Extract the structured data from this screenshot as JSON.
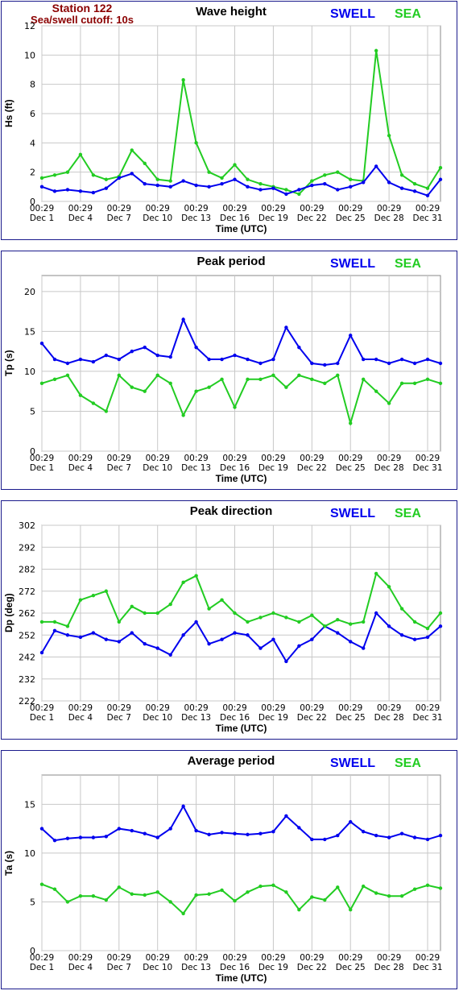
{
  "station": {
    "name": "Station 122",
    "cutoff": "Sea/swell cutoff: 10s"
  },
  "legend": {
    "swell": "SWELL",
    "sea": "SEA"
  },
  "colors": {
    "swell": "#0000ee",
    "sea": "#22cc22",
    "grid": "#c8c8c8",
    "border": "#1a1a8c",
    "station": "#8b0000"
  },
  "x_axis": {
    "label": "Time (UTC)",
    "ticks": [
      {
        "time": "00:29",
        "date": "Dec 1"
      },
      {
        "time": "00:29",
        "date": "Dec 4"
      },
      {
        "time": "00:29",
        "date": "Dec 7"
      },
      {
        "time": "00:29",
        "date": "Dec 10"
      },
      {
        "time": "00:29",
        "date": "Dec 13"
      },
      {
        "time": "00:29",
        "date": "Dec 16"
      },
      {
        "time": "00:29",
        "date": "Dec 19"
      },
      {
        "time": "00:29",
        "date": "Dec 22"
      },
      {
        "time": "00:29",
        "date": "Dec 25"
      },
      {
        "time": "00:29",
        "date": "Dec 28"
      },
      {
        "time": "00:29",
        "date": "Dec 31"
      }
    ]
  },
  "chart_data": [
    {
      "type": "line",
      "title": "Wave height",
      "ylabel": "Hs (ft)",
      "xlabel": "Time (UTC)",
      "ylim": [
        0,
        12
      ],
      "yticks": [
        0,
        2,
        4,
        6,
        8,
        10,
        12
      ],
      "grid": true,
      "legend": "top-right",
      "x": [
        "Dec 1",
        "Dec 2",
        "Dec 3",
        "Dec 4",
        "Dec 5",
        "Dec 6",
        "Dec 7",
        "Dec 8",
        "Dec 9",
        "Dec 10",
        "Dec 11",
        "Dec 12",
        "Dec 13",
        "Dec 14",
        "Dec 15",
        "Dec 16",
        "Dec 17",
        "Dec 18",
        "Dec 19",
        "Dec 20",
        "Dec 21",
        "Dec 22",
        "Dec 23",
        "Dec 24",
        "Dec 25",
        "Dec 26",
        "Dec 27",
        "Dec 28",
        "Dec 29",
        "Dec 30",
        "Dec 31",
        "Jan 1"
      ],
      "series": [
        {
          "name": "SWELL",
          "values": [
            1.0,
            0.7,
            0.8,
            0.7,
            0.6,
            0.9,
            1.6,
            1.9,
            1.2,
            1.1,
            1.0,
            1.4,
            1.1,
            1.0,
            1.2,
            1.5,
            1.0,
            0.8,
            0.9,
            0.5,
            0.8,
            1.1,
            1.2,
            0.8,
            1.0,
            1.3,
            2.4,
            1.3,
            0.9,
            0.7,
            0.4,
            1.5
          ]
        },
        {
          "name": "SEA",
          "values": [
            1.6,
            1.8,
            2.0,
            3.2,
            1.8,
            1.5,
            1.7,
            3.5,
            2.6,
            1.5,
            1.4,
            8.3,
            4.0,
            2.0,
            1.6,
            2.5,
            1.5,
            1.2,
            1.0,
            0.8,
            0.5,
            1.4,
            1.8,
            2.0,
            1.5,
            1.4,
            10.3,
            4.5,
            1.8,
            1.2,
            0.9,
            2.3
          ]
        }
      ]
    },
    {
      "type": "line",
      "title": "Peak period",
      "ylabel": "Tp (s)",
      "xlabel": "Time (UTC)",
      "ylim": [
        0,
        22
      ],
      "yticks": [
        0,
        5,
        10,
        15,
        20
      ],
      "grid": true,
      "legend": "top-right",
      "x": [
        "Dec 1",
        "Dec 2",
        "Dec 3",
        "Dec 4",
        "Dec 5",
        "Dec 6",
        "Dec 7",
        "Dec 8",
        "Dec 9",
        "Dec 10",
        "Dec 11",
        "Dec 12",
        "Dec 13",
        "Dec 14",
        "Dec 15",
        "Dec 16",
        "Dec 17",
        "Dec 18",
        "Dec 19",
        "Dec 20",
        "Dec 21",
        "Dec 22",
        "Dec 23",
        "Dec 24",
        "Dec 25",
        "Dec 26",
        "Dec 27",
        "Dec 28",
        "Dec 29",
        "Dec 30",
        "Dec 31",
        "Jan 1"
      ],
      "series": [
        {
          "name": "SWELL",
          "values": [
            13.5,
            11.5,
            11.0,
            11.5,
            11.2,
            12.0,
            11.5,
            12.5,
            13.0,
            12.0,
            11.8,
            16.5,
            13.0,
            11.5,
            11.5,
            12.0,
            11.5,
            11.0,
            11.5,
            15.5,
            13.0,
            11.0,
            10.8,
            11.0,
            14.5,
            11.5,
            11.5,
            11.0,
            11.5,
            11.0,
            11.5,
            11.0
          ]
        },
        {
          "name": "SEA",
          "values": [
            8.5,
            9.0,
            9.5,
            7.0,
            6.0,
            5.0,
            9.5,
            8.0,
            7.5,
            9.5,
            8.5,
            4.5,
            7.5,
            8.0,
            9.0,
            5.5,
            9.0,
            9.0,
            9.5,
            8.0,
            9.5,
            9.0,
            8.5,
            9.5,
            3.5,
            9.0,
            7.5,
            6.0,
            8.5,
            8.5,
            9.0,
            8.5
          ]
        }
      ]
    },
    {
      "type": "line",
      "title": "Peak direction",
      "ylabel": "Dp (deg)",
      "xlabel": "Time (UTC)",
      "ylim": [
        222,
        302
      ],
      "yticks": [
        222,
        232,
        242,
        252,
        262,
        272,
        282,
        292,
        302
      ],
      "grid": true,
      "legend": "top-right",
      "x": [
        "Dec 1",
        "Dec 2",
        "Dec 3",
        "Dec 4",
        "Dec 5",
        "Dec 6",
        "Dec 7",
        "Dec 8",
        "Dec 9",
        "Dec 10",
        "Dec 11",
        "Dec 12",
        "Dec 13",
        "Dec 14",
        "Dec 15",
        "Dec 16",
        "Dec 17",
        "Dec 18",
        "Dec 19",
        "Dec 20",
        "Dec 21",
        "Dec 22",
        "Dec 23",
        "Dec 24",
        "Dec 25",
        "Dec 26",
        "Dec 27",
        "Dec 28",
        "Dec 29",
        "Dec 30",
        "Dec 31",
        "Jan 1"
      ],
      "series": [
        {
          "name": "SWELL",
          "values": [
            244,
            254,
            252,
            251,
            253,
            250,
            249,
            253,
            248,
            246,
            243,
            252,
            258,
            248,
            250,
            253,
            252,
            246,
            250,
            240,
            247,
            250,
            256,
            253,
            249,
            246,
            262,
            256,
            252,
            250,
            251,
            256
          ]
        },
        {
          "name": "SEA",
          "values": [
            258,
            258,
            256,
            268,
            270,
            272,
            258,
            265,
            262,
            262,
            266,
            276,
            279,
            264,
            268,
            262,
            258,
            260,
            262,
            260,
            258,
            261,
            256,
            259,
            257,
            258,
            280,
            274,
            264,
            258,
            255,
            262
          ]
        }
      ]
    },
    {
      "type": "line",
      "title": "Average period",
      "ylabel": "Ta (s)",
      "xlabel": "Time (UTC)",
      "ylim": [
        0,
        18
      ],
      "yticks": [
        0,
        5,
        10,
        15
      ],
      "grid": true,
      "legend": "top-right",
      "x": [
        "Dec 1",
        "Dec 2",
        "Dec 3",
        "Dec 4",
        "Dec 5",
        "Dec 6",
        "Dec 7",
        "Dec 8",
        "Dec 9",
        "Dec 10",
        "Dec 11",
        "Dec 12",
        "Dec 13",
        "Dec 14",
        "Dec 15",
        "Dec 16",
        "Dec 17",
        "Dec 18",
        "Dec 19",
        "Dec 20",
        "Dec 21",
        "Dec 22",
        "Dec 23",
        "Dec 24",
        "Dec 25",
        "Dec 26",
        "Dec 27",
        "Dec 28",
        "Dec 29",
        "Dec 30",
        "Dec 31",
        "Jan 1"
      ],
      "series": [
        {
          "name": "SWELL",
          "values": [
            12.5,
            11.3,
            11.5,
            11.6,
            11.6,
            11.7,
            12.5,
            12.3,
            12.0,
            11.6,
            12.5,
            14.8,
            12.3,
            11.9,
            12.1,
            12.0,
            11.9,
            12.0,
            12.2,
            13.8,
            12.6,
            11.4,
            11.4,
            11.8,
            13.2,
            12.2,
            11.8,
            11.6,
            12.0,
            11.6,
            11.4,
            11.8
          ]
        },
        {
          "name": "SEA",
          "values": [
            6.8,
            6.3,
            5.0,
            5.6,
            5.6,
            5.2,
            6.5,
            5.8,
            5.7,
            6.0,
            5.0,
            3.8,
            5.7,
            5.8,
            6.2,
            5.1,
            6.0,
            6.6,
            6.7,
            6.0,
            4.2,
            5.5,
            5.2,
            6.5,
            4.2,
            6.6,
            5.9,
            5.6,
            5.6,
            6.3,
            6.7,
            6.4
          ]
        }
      ]
    }
  ]
}
